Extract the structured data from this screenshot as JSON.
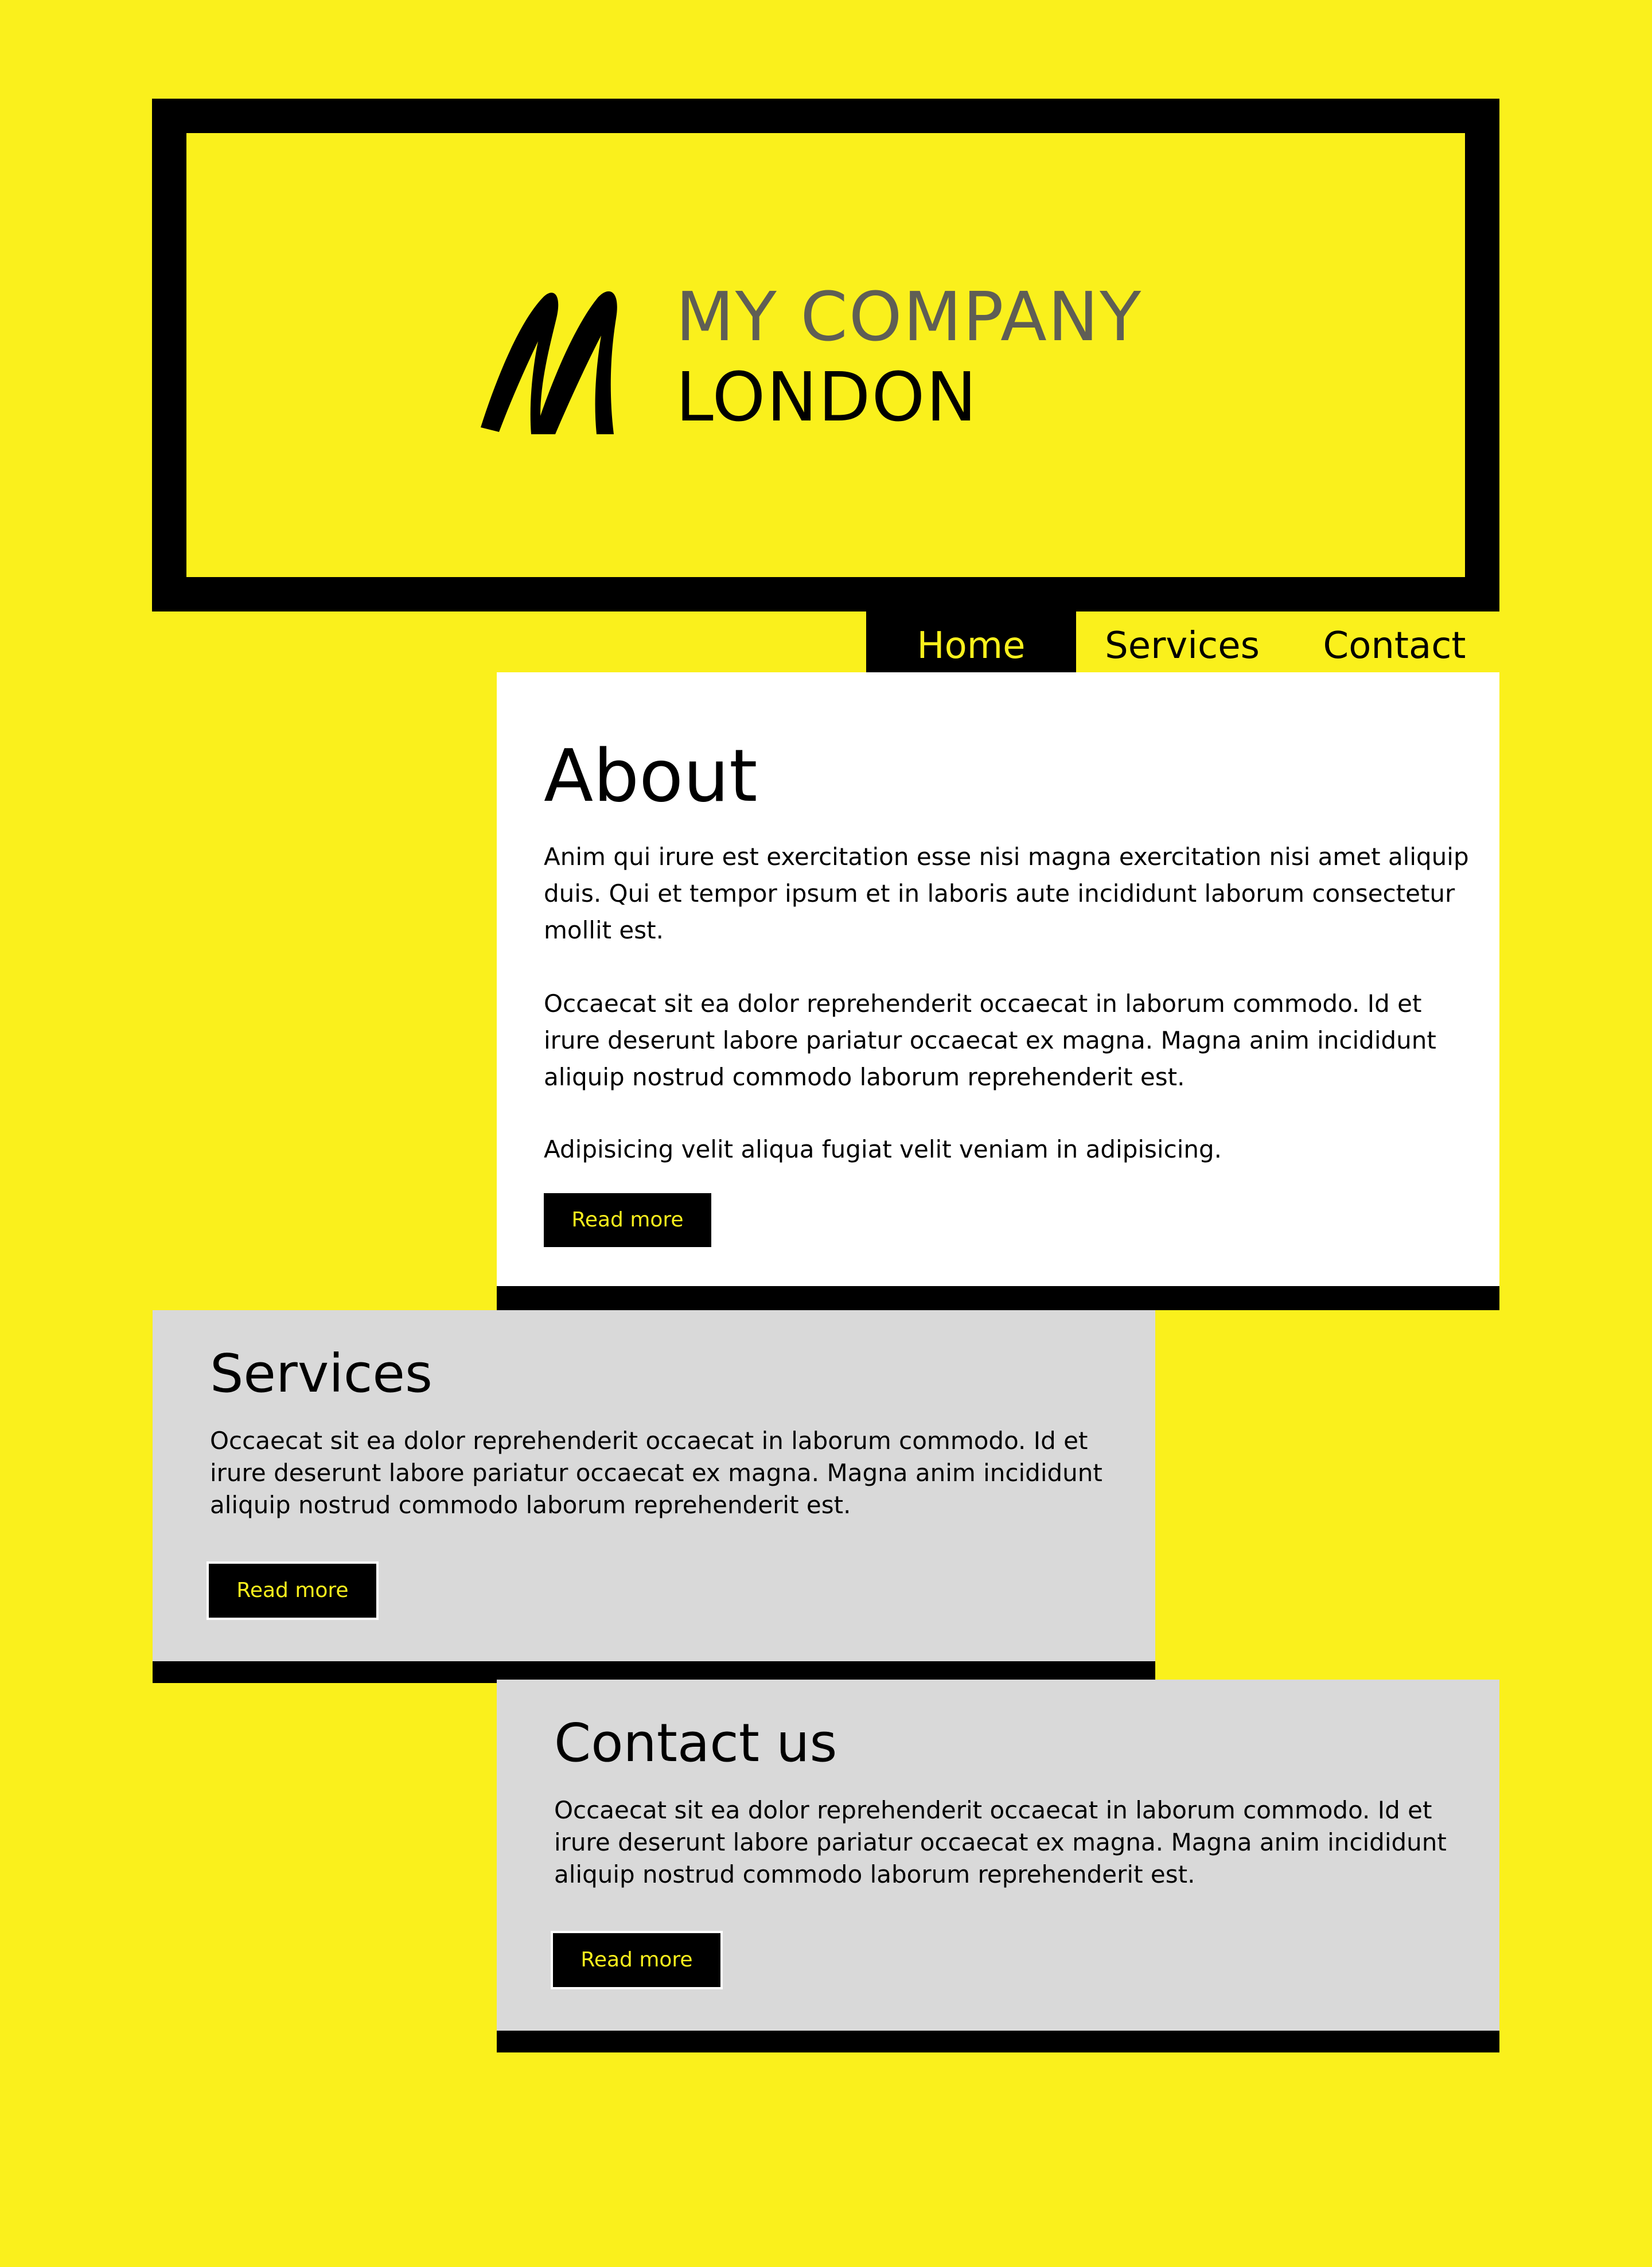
{
  "brand": {
    "logo_letter": "M",
    "line1": "MY COMPANY",
    "line2": "LONDON"
  },
  "nav": {
    "items": [
      {
        "label": "Home",
        "active": true
      },
      {
        "label": "Services",
        "active": false
      },
      {
        "label": "Contact",
        "active": false
      }
    ]
  },
  "about": {
    "title": "About",
    "paragraphs": [
      "Anim qui irure est exercitation esse nisi magna exercitation nisi amet aliquip duis. Qui et tempor ipsum et in laboris aute incididunt laborum consectetur mollit est.",
      "Occaecat sit ea dolor reprehenderit occaecat in laborum commodo. Id et irure deserunt labore pariatur occaecat ex magna. Magna anim incididunt aliquip nostrud commodo laborum reprehenderit est.",
      "Adipisicing velit aliqua fugiat velit veniam in adipisicing."
    ],
    "button_label": "Read more"
  },
  "services": {
    "title": "Services",
    "text": "Occaecat sit ea dolor reprehenderit occaecat in laborum commodo. Id et irure deserunt labore pariatur occaecat ex magna. Magna anim incididunt aliquip nostrud commodo laborum reprehenderit est.",
    "button_label": "Read more"
  },
  "contact": {
    "title": "Contact us",
    "text": "Occaecat sit ea dolor reprehenderit occaecat in laborum commodo. Id et irure deserunt labore pariatur occaecat ex magna. Magna anim incididunt aliquip nostrud commodo laborum reprehenderit est.",
    "button_label": "Read more"
  },
  "colors": {
    "background": "#FAF01C",
    "dark": "#000000",
    "card_white": "#FFFFFF",
    "card_gray": "#D9D9D9",
    "brand_gray": "#5F5E55"
  },
  "icons": {
    "logo": "m-script-logo-icon"
  }
}
